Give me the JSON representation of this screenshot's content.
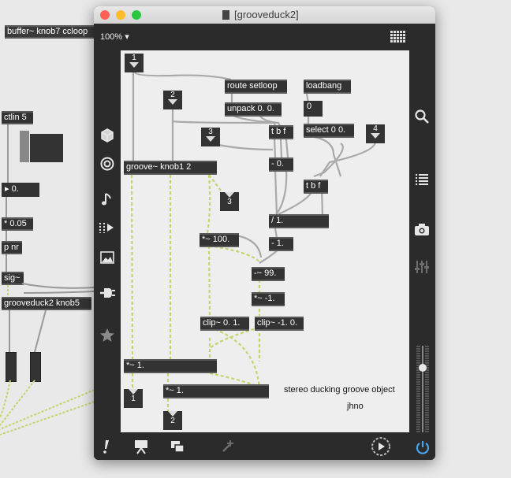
{
  "background_patcher": {
    "objects": [
      "buffer~ knob7 ccloop",
      "ctlin 5",
      "0.",
      "* 0.05",
      "p nr",
      "sig~",
      "grooveduck2 knob5"
    ]
  },
  "window": {
    "title": "[grooveduck2]",
    "zoom": "100%",
    "zoom_arrow": "▾"
  },
  "patch": {
    "objects": {
      "route": "route setloop",
      "unpack": "unpack 0. 0.",
      "loadbang": "loadbang",
      "num_zero": "0",
      "tbf1": "t b f",
      "select": "select 0 0.",
      "groove": "groove~ knob1 2",
      "minus0": "- 0.",
      "tbf2": "t b f",
      "div1": "/ 1.",
      "mul100": "*~ 100.",
      "minus1": "- 1.",
      "sub99": "-~ 99.",
      "mulneg1": "*~ -1.",
      "clip01": "clip~ 0. 1.",
      "clipneg": "clip~ -1. 0.",
      "mul1a": "*~ 1.",
      "mul1b": "*~ 1."
    },
    "inlets": {
      "in1": "1",
      "in2": "2",
      "in3": "3",
      "in4": "4"
    },
    "outlets": {
      "out3": "3",
      "out1": "1",
      "out2": "2"
    },
    "comments": {
      "desc": "stereo ducking groove object",
      "author": "jhno"
    }
  },
  "sidebar_left": [
    "cube-icon",
    "target-icon",
    "music-note-icon",
    "playlist-icon",
    "image-icon",
    "plug-icon",
    "star-icon"
  ],
  "sidebar_right": [
    "search-icon",
    "list-icon",
    "camera-icon",
    "sliders-icon"
  ],
  "colors": {
    "patch_bg": "#eeeeee",
    "toolbar": "#2b2b2b",
    "object": "#333333",
    "cable_signal": "#c7d36b",
    "cable_control": "#a9a9a9"
  }
}
